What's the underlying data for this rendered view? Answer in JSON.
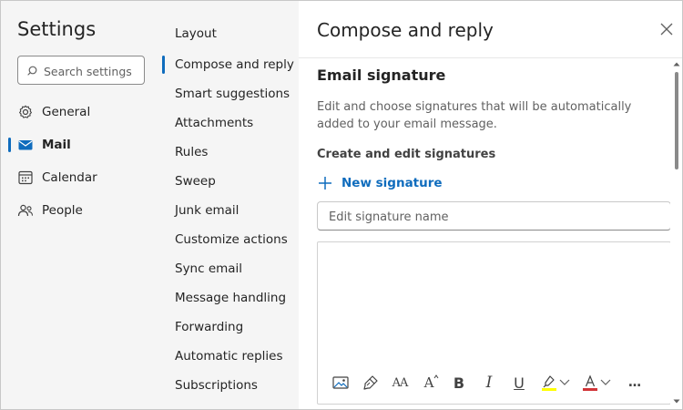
{
  "app": {
    "title": "Settings",
    "search_placeholder": "Search settings"
  },
  "nav": [
    {
      "label": "General",
      "icon": "gear-icon",
      "selected": false
    },
    {
      "label": "Mail",
      "icon": "mail-icon",
      "selected": true
    },
    {
      "label": "Calendar",
      "icon": "calendar-icon",
      "selected": false
    },
    {
      "label": "People",
      "icon": "people-icon",
      "selected": false
    }
  ],
  "mail_settings": [
    {
      "label": "Layout",
      "selected": false
    },
    {
      "label": "Compose and reply",
      "selected": true
    },
    {
      "label": "Smart suggestions",
      "selected": false
    },
    {
      "label": "Attachments",
      "selected": false
    },
    {
      "label": "Rules",
      "selected": false
    },
    {
      "label": "Sweep",
      "selected": false
    },
    {
      "label": "Junk email",
      "selected": false
    },
    {
      "label": "Customize actions",
      "selected": false
    },
    {
      "label": "Sync email",
      "selected": false
    },
    {
      "label": "Message handling",
      "selected": false
    },
    {
      "label": "Forwarding",
      "selected": false
    },
    {
      "label": "Automatic replies",
      "selected": false
    },
    {
      "label": "Subscriptions",
      "selected": false
    }
  ],
  "panel": {
    "title": "Compose and reply",
    "section_title": "Email signature",
    "description": "Edit and choose signatures that will be automatically added to your email message.",
    "subheading": "Create and edit signatures",
    "new_signature_label": "New signature",
    "signature_name_placeholder": "Edit signature name",
    "signature_name_value": "",
    "signature_body": ""
  },
  "toolbar": {
    "font_size_glyph": "AA",
    "grow_glyph": "A",
    "bold_glyph": "B",
    "italic_glyph": "I",
    "underline_glyph": "U",
    "font_color_glyph": "A",
    "more_glyph": "…"
  },
  "colors": {
    "accent": "#0f6cbd",
    "highlight": "#ffff00",
    "font_color": "#d13438"
  }
}
